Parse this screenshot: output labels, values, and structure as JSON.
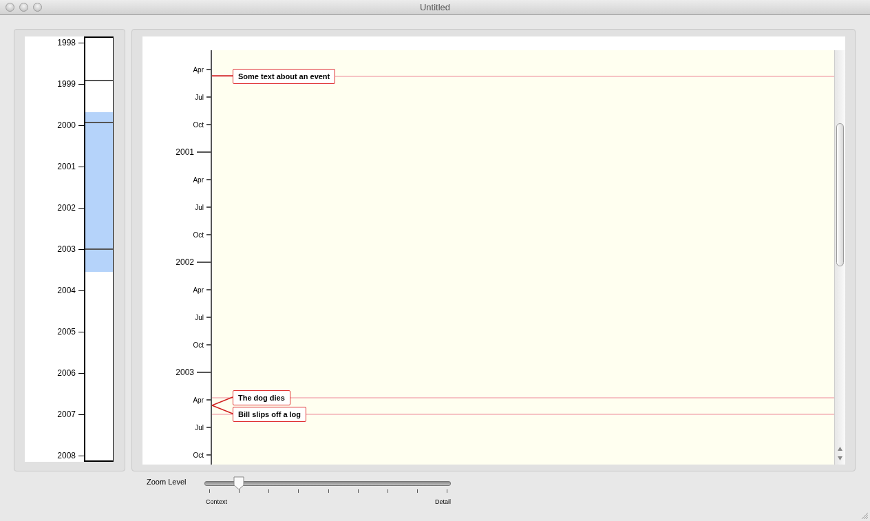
{
  "window": {
    "title": "Untitled"
  },
  "overview": {
    "years": [
      "1998",
      "1999",
      "2000",
      "2001",
      "2002",
      "2003",
      "2004",
      "2005",
      "2006",
      "2007",
      "2008"
    ]
  },
  "timeline": {
    "ticks": [
      {
        "label": "Apr",
        "kind": "month"
      },
      {
        "label": "Jul",
        "kind": "month"
      },
      {
        "label": "Oct",
        "kind": "month"
      },
      {
        "label": "2001",
        "kind": "year"
      },
      {
        "label": "Apr",
        "kind": "month"
      },
      {
        "label": "Jul",
        "kind": "month"
      },
      {
        "label": "Oct",
        "kind": "month"
      },
      {
        "label": "2002",
        "kind": "year"
      },
      {
        "label": "Apr",
        "kind": "month"
      },
      {
        "label": "Jul",
        "kind": "month"
      },
      {
        "label": "Oct",
        "kind": "month"
      },
      {
        "label": "2003",
        "kind": "year"
      },
      {
        "label": "Apr",
        "kind": "month"
      },
      {
        "label": "Jul",
        "kind": "month"
      },
      {
        "label": "Oct",
        "kind": "month"
      }
    ],
    "events": [
      {
        "label": "Some text about an event"
      },
      {
        "label": "The dog dies"
      },
      {
        "label": "Bill slips off a log"
      }
    ]
  },
  "zoom": {
    "label": "Zoom Level",
    "level": 0.125,
    "min_label": "Context",
    "max_label": "Detail"
  }
}
